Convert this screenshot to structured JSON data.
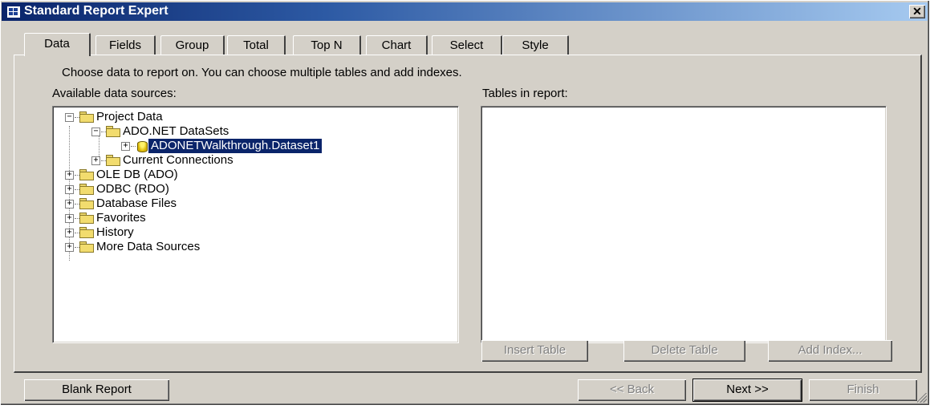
{
  "window": {
    "title": "Standard Report Expert",
    "close_glyph": "✕"
  },
  "tabs": [
    {
      "label": "Data",
      "active": true
    },
    {
      "label": "Fields"
    },
    {
      "label": "Group"
    },
    {
      "label": "Total"
    },
    {
      "label": "Top N"
    },
    {
      "label": "Chart"
    },
    {
      "label": "Select"
    },
    {
      "label": "Style"
    }
  ],
  "data_tab": {
    "instruction": "Choose data to report on. You can choose multiple tables and add indexes.",
    "available_label": "Available data sources:",
    "tables_label": "Tables in report:",
    "tree": [
      {
        "label": "Project Data",
        "level": 0,
        "expanded": true,
        "icon": "folder-icon"
      },
      {
        "label": "ADO.NET DataSets",
        "level": 1,
        "expanded": true,
        "icon": "folder-icon"
      },
      {
        "label": "ADONETWalkthrough.Dataset1",
        "level": 2,
        "expanded": false,
        "icon": "database-icon",
        "selected": true
      },
      {
        "label": "Current Connections",
        "level": 1,
        "expanded": false,
        "icon": "folder-icon"
      },
      {
        "label": "OLE DB (ADO)",
        "level": 0,
        "expanded": false,
        "icon": "folder-icon"
      },
      {
        "label": "ODBC (RDO)",
        "level": 0,
        "expanded": false,
        "icon": "folder-icon"
      },
      {
        "label": "Database Files",
        "level": 0,
        "expanded": false,
        "icon": "folder-icon"
      },
      {
        "label": "Favorites",
        "level": 0,
        "expanded": false,
        "icon": "folder-icon"
      },
      {
        "label": "History",
        "level": 0,
        "expanded": false,
        "icon": "folder-icon"
      },
      {
        "label": "More Data Sources",
        "level": 0,
        "expanded": false,
        "icon": "folder-icon"
      }
    ],
    "buttons": {
      "insert_table": "Insert Table",
      "delete_table": "Delete Table",
      "add_index": "Add Index..."
    }
  },
  "footer": {
    "blank_report": "Blank Report",
    "back": "<< Back",
    "next": "Next >>",
    "finish": "Finish"
  },
  "colors": {
    "titlebar_start": "#0a246a",
    "titlebar_end": "#a6caf0",
    "dialog_face": "#d4d0c8",
    "selection": "#0a246a"
  }
}
